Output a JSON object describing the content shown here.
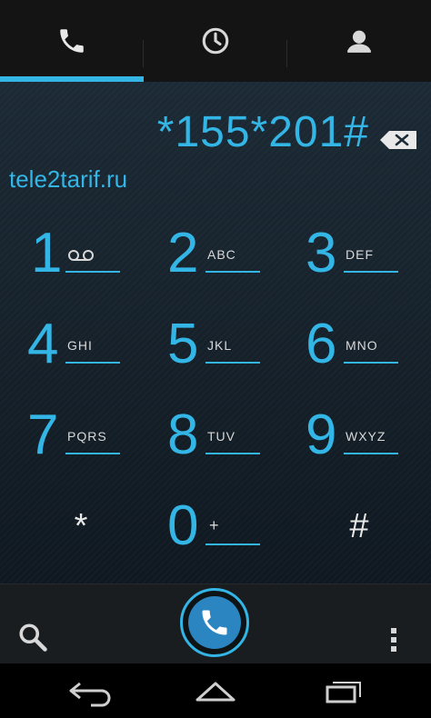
{
  "tabs": [
    {
      "icon": "phone-icon"
    },
    {
      "icon": "clock-icon"
    },
    {
      "icon": "contacts-icon"
    }
  ],
  "dialer": {
    "number": "*155*201#",
    "watermark": "tele2tarif.ru"
  },
  "keys": [
    {
      "digit": "1",
      "letters": "",
      "icon": "voicemail-icon"
    },
    {
      "digit": "2",
      "letters": "ABC"
    },
    {
      "digit": "3",
      "letters": "DEF"
    },
    {
      "digit": "4",
      "letters": "GHI"
    },
    {
      "digit": "5",
      "letters": "JKL"
    },
    {
      "digit": "6",
      "letters": "MNO"
    },
    {
      "digit": "7",
      "letters": "PQRS"
    },
    {
      "digit": "8",
      "letters": "TUV"
    },
    {
      "digit": "9",
      "letters": "WXYZ"
    },
    {
      "symbol": "*"
    },
    {
      "digit": "0",
      "letters": "+"
    },
    {
      "symbol": "#"
    }
  ],
  "colors": {
    "accent": "#33b5e5",
    "background": "#1c2a35"
  }
}
